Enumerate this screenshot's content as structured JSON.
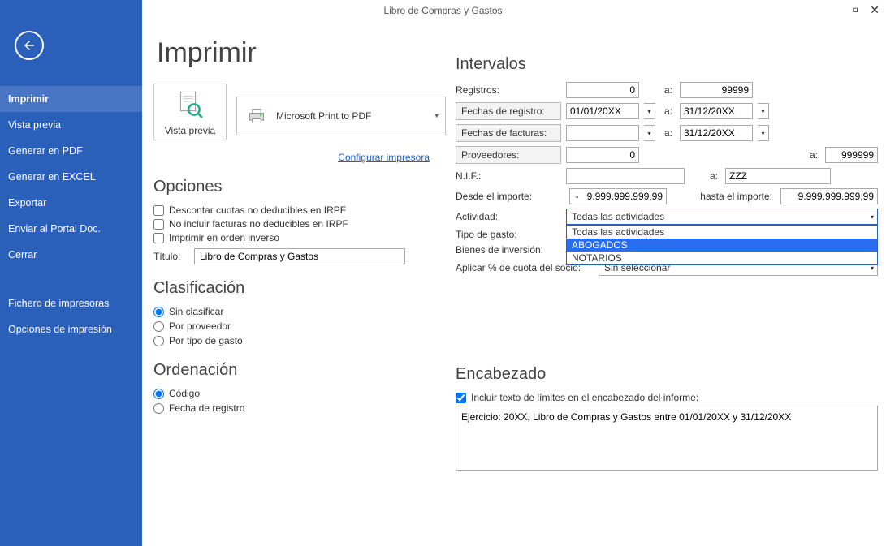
{
  "window": {
    "title": "Libro de Compras y Gastos"
  },
  "sidebar": {
    "items": [
      "Imprimir",
      "Vista previa",
      "Generar en PDF",
      "Generar en EXCEL",
      "Exportar",
      "Enviar al Portal Doc.",
      "Cerrar"
    ],
    "items2": [
      "Fichero de impresoras",
      "Opciones de impresión"
    ]
  },
  "page": {
    "heading": "Imprimir",
    "preview_label": "Vista previa",
    "printer_name": "Microsoft Print to PDF",
    "config_link": "Configurar impresora"
  },
  "opciones": {
    "heading": "Opciones",
    "chk1": "Descontar cuotas no deducibles en IRPF",
    "chk2": "No incluir facturas no deducibles en IRPF",
    "chk3": "Imprimir en orden inverso",
    "titulo_label": "Título:",
    "titulo_value": "Libro de Compras y Gastos"
  },
  "clasificacion": {
    "heading": "Clasificación",
    "r1": "Sin clasificar",
    "r2": "Por proveedor",
    "r3": "Por tipo de gasto"
  },
  "ordenacion": {
    "heading": "Ordenación",
    "r1": "Código",
    "r2": "Fecha de registro"
  },
  "intervalos": {
    "heading": "Intervalos",
    "registros_label": "Registros:",
    "registros_from": "0",
    "registros_to": "99999",
    "a": "a:",
    "fechas_registro_label": "Fechas de registro:",
    "fechas_registro_from": "01/01/20XX",
    "fechas_registro_to": "31/12/20XX",
    "fechas_facturas_label": "Fechas de facturas:",
    "fechas_facturas_from": "",
    "fechas_facturas_to": "31/12/20XX",
    "proveedores_label": "Proveedores:",
    "proveedores_from": "0",
    "proveedores_to": "999999",
    "nif_label": "N.I.F.:",
    "nif_from": "",
    "nif_to": "ZZZ",
    "desde_importe_label": "Desde el importe:",
    "desde_importe": "-   9.999.999.999,99",
    "hasta_importe_label": "hasta el importe:",
    "hasta_importe": "9.999.999.999,99",
    "actividad_label": "Actividad:",
    "actividad_selected": "Todas las actividades",
    "actividad_options": [
      "Todas las actividades",
      "ABOGADOS",
      "NOTARIOS"
    ],
    "tipo_gasto_label": "Tipo de gasto:",
    "bienes_label": "Bienes de inversión:",
    "aplicar_label": "Aplicar % de cuota del socio:",
    "aplicar_value": "Sin seleccionar"
  },
  "encabezado": {
    "heading": "Encabezado",
    "chk": "Incluir texto de límites en el encabezado del informe:",
    "text": "Ejercicio: 20XX, Libro de Compras y Gastos entre 01/01/20XX y 31/12/20XX"
  }
}
